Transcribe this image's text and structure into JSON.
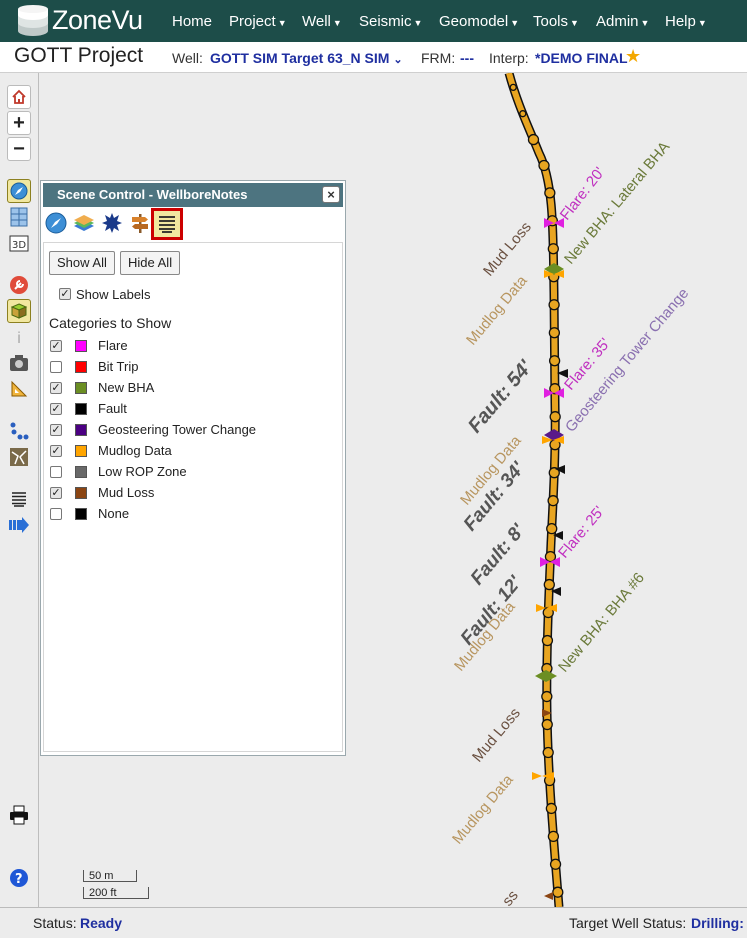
{
  "app": {
    "name": "ZoneVu"
  },
  "nav": {
    "items": [
      "Home",
      "Project",
      "Well",
      "Seismic",
      "Geomodel",
      "Tools",
      "Admin",
      "Help"
    ]
  },
  "project": {
    "title": "GOTT Project",
    "well_label": "Well:",
    "well_value": "GOTT SIM Target 63_N SIM",
    "frm_label": "FRM:",
    "frm_value": "---",
    "interp_label": "Interp:",
    "interp_value": "*DEMO FINAL"
  },
  "panel": {
    "title": "Scene Control - WellboreNotes",
    "close": "×",
    "show_all": "Show All",
    "hide_all": "Hide All",
    "show_labels": "Show Labels",
    "show_labels_checked": true,
    "categories_heading": "Categories to Show",
    "categories": [
      {
        "label": "Flare",
        "color": "#ff00ff",
        "checked": true
      },
      {
        "label": "Bit Trip",
        "color": "#ff0000",
        "checked": false
      },
      {
        "label": "New BHA",
        "color": "#6b8e23",
        "checked": true
      },
      {
        "label": "Fault",
        "color": "#000000",
        "checked": true
      },
      {
        "label": "Geosteering Tower Change",
        "color": "#4b0082",
        "checked": true
      },
      {
        "label": "Mudlog Data",
        "color": "#ffa500",
        "checked": true
      },
      {
        "label": "Low ROP Zone",
        "color": "#696969",
        "checked": false
      },
      {
        "label": "Mud Loss",
        "color": "#8b4513",
        "checked": true
      },
      {
        "label": "None",
        "color": "#000000",
        "checked": false
      }
    ]
  },
  "map": {
    "labels": {
      "flare_20": "Flare: 20'",
      "new_bha_lateral": "New BHA: Lateral BHA",
      "mud_loss_1": "Mud Loss",
      "mudlog_1": "Mudlog Data",
      "flare_35": "Flare: 35'",
      "geo_tower": "Geosteering Tower Change",
      "fault_54": "Fault: 54'",
      "mudlog_2": "Mudlog Data",
      "fault_34": "Fault: 34'",
      "flare_25": "Flare: 25'",
      "fault_8": "Fault: 8'",
      "fault_12": "Fault: 12'",
      "mudlog_3": "Mudlog Data",
      "new_bha_6": "New BHA: BHA #6",
      "mud_loss_2": "Mud Loss",
      "mudlog_4": "Mudlog Data",
      "partial": "ss"
    },
    "scale_m": "50 m",
    "scale_ft": "200 ft"
  },
  "status": {
    "label": "Status:",
    "value": "Ready",
    "target_label": "Target Well Status:",
    "target_value": "Drilling:"
  },
  "icons": {
    "toolbar": [
      "home-icon",
      "zoom-in-icon",
      "zoom-out-icon",
      "compass-icon",
      "grid-view-icon",
      "3d-view-icon",
      "wrench-icon",
      "layers-cube-icon",
      "info-icon",
      "camera-icon",
      "ruler-icon",
      "points-icon",
      "fault-icon",
      "wellbore-notes-icon",
      "arrow-icon",
      "print-icon",
      "help-icon"
    ],
    "panel_tabs": [
      "compass-icon",
      "layers-icon",
      "seismic-icon",
      "signpost-icon",
      "wellbore-notes-icon"
    ]
  },
  "colors": {
    "nav_bg": "#1d4d49",
    "panel_header": "#4d7480",
    "link_blue": "#1f2fa0",
    "wellbore": "#e8a521"
  }
}
